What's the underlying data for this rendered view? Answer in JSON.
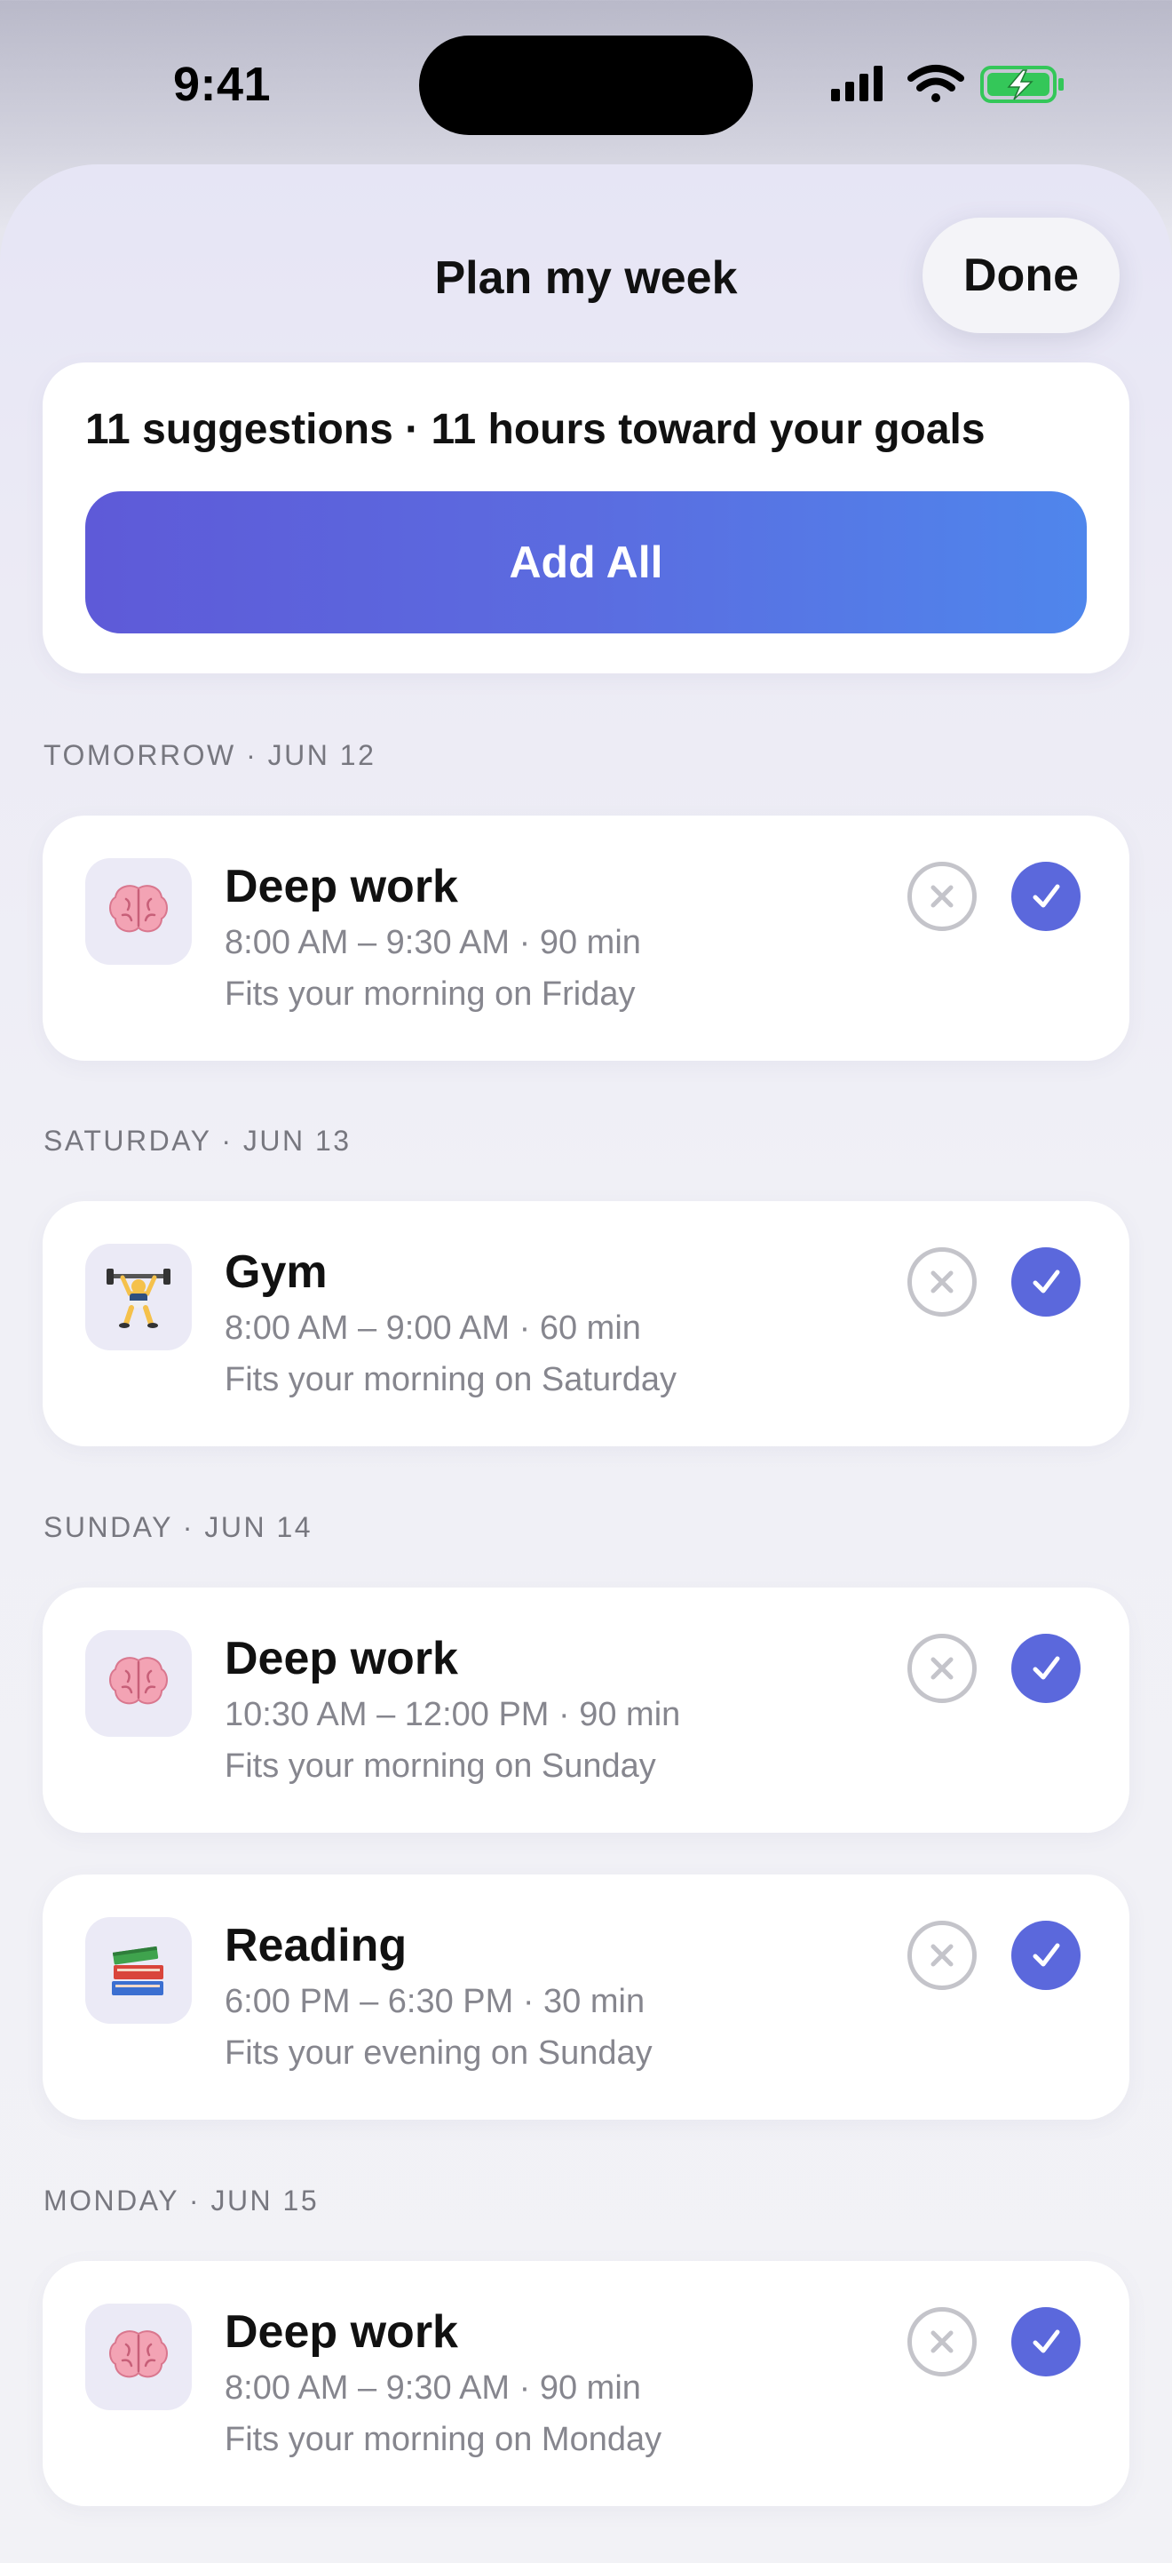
{
  "status_bar": {
    "time": "9:41",
    "icons": [
      "cellular-signal-icon",
      "wifi-icon",
      "battery-charging-icon"
    ],
    "battery_color": "#34c759"
  },
  "header": {
    "title": "Plan my week",
    "done_label": "Done"
  },
  "summary": {
    "text": "11 suggestions · 11 hours toward your goals",
    "add_all_label": "Add All",
    "accent_gradient": [
      "#5e5ad8",
      "#4f86ec"
    ]
  },
  "sections": [
    {
      "header": "TOMORROW · JUN 12",
      "items": [
        {
          "icon": "brain-icon",
          "title": "Deep work",
          "time": "8:00 AM – 9:30 AM · 90 min",
          "note": "Fits your morning on Friday"
        }
      ]
    },
    {
      "header": "SATURDAY · JUN 13",
      "items": [
        {
          "icon": "weightlifter-icon",
          "title": "Gym",
          "time": "8:00 AM – 9:00 AM · 60 min",
          "note": "Fits your morning on Saturday"
        }
      ]
    },
    {
      "header": "SUNDAY · JUN 14",
      "items": [
        {
          "icon": "brain-icon",
          "title": "Deep work",
          "time": "10:30 AM – 12:00 PM · 90 min",
          "note": "Fits your morning on Sunday"
        },
        {
          "icon": "books-icon",
          "title": "Reading",
          "time": "6:00 PM – 6:30 PM · 30 min",
          "note": "Fits your evening on Sunday"
        }
      ]
    },
    {
      "header": "MONDAY · JUN 15",
      "items": [
        {
          "icon": "brain-icon",
          "title": "Deep work",
          "time": "8:00 AM – 9:30 AM · 90 min",
          "note": "Fits your morning on Monday"
        }
      ]
    }
  ],
  "colors": {
    "accept": "#5b68dc",
    "reject_outline": "#c4c4ca"
  }
}
